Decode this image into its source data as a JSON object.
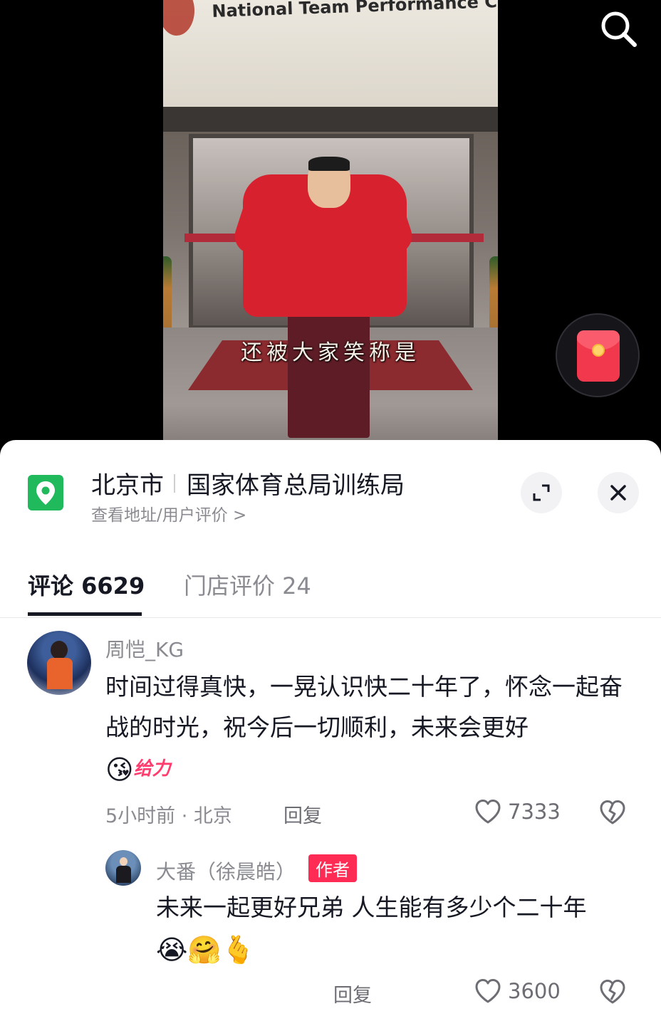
{
  "video": {
    "sign_text": "National Team Performance Cen",
    "subtitle": "还被大家笑称是"
  },
  "location": {
    "city": "北京市",
    "place": "国家体育总局训练局",
    "link": "查看地址/用户评价 >"
  },
  "tabs": [
    {
      "label": "评论 6629",
      "active": true
    },
    {
      "label": "门店评价 24",
      "active": false
    }
  ],
  "comments": [
    {
      "user": "周恺_KG",
      "text": "时间过得真快，一晃认识快二十年了，怀念一起奋战的时光，祝今后一切顺利，未来会更好",
      "emoji": "😘",
      "sticker": "给力",
      "time_location": "5小时前 · 北京",
      "reply_label": "回复",
      "likes": "7333"
    }
  ],
  "replies": [
    {
      "user": "大番（徐晨皓）",
      "badge": "作者",
      "text": "未来一起更好兄弟 人生能有多少个二十年",
      "emojis": "😭🤗🫰",
      "reply_label": "回复",
      "likes": "3600"
    }
  ],
  "icons": {
    "search": "search-icon",
    "red_packet": "red-packet-icon",
    "location": "map-pin-icon",
    "expand": "expand-icon",
    "close": "close-icon",
    "like": "heart-icon",
    "dislike": "broken-heart-icon"
  },
  "colors": {
    "accent": "#fe2c55",
    "location_green": "#20b95c",
    "text": "#161823",
    "secondary": "#8a8b91"
  }
}
